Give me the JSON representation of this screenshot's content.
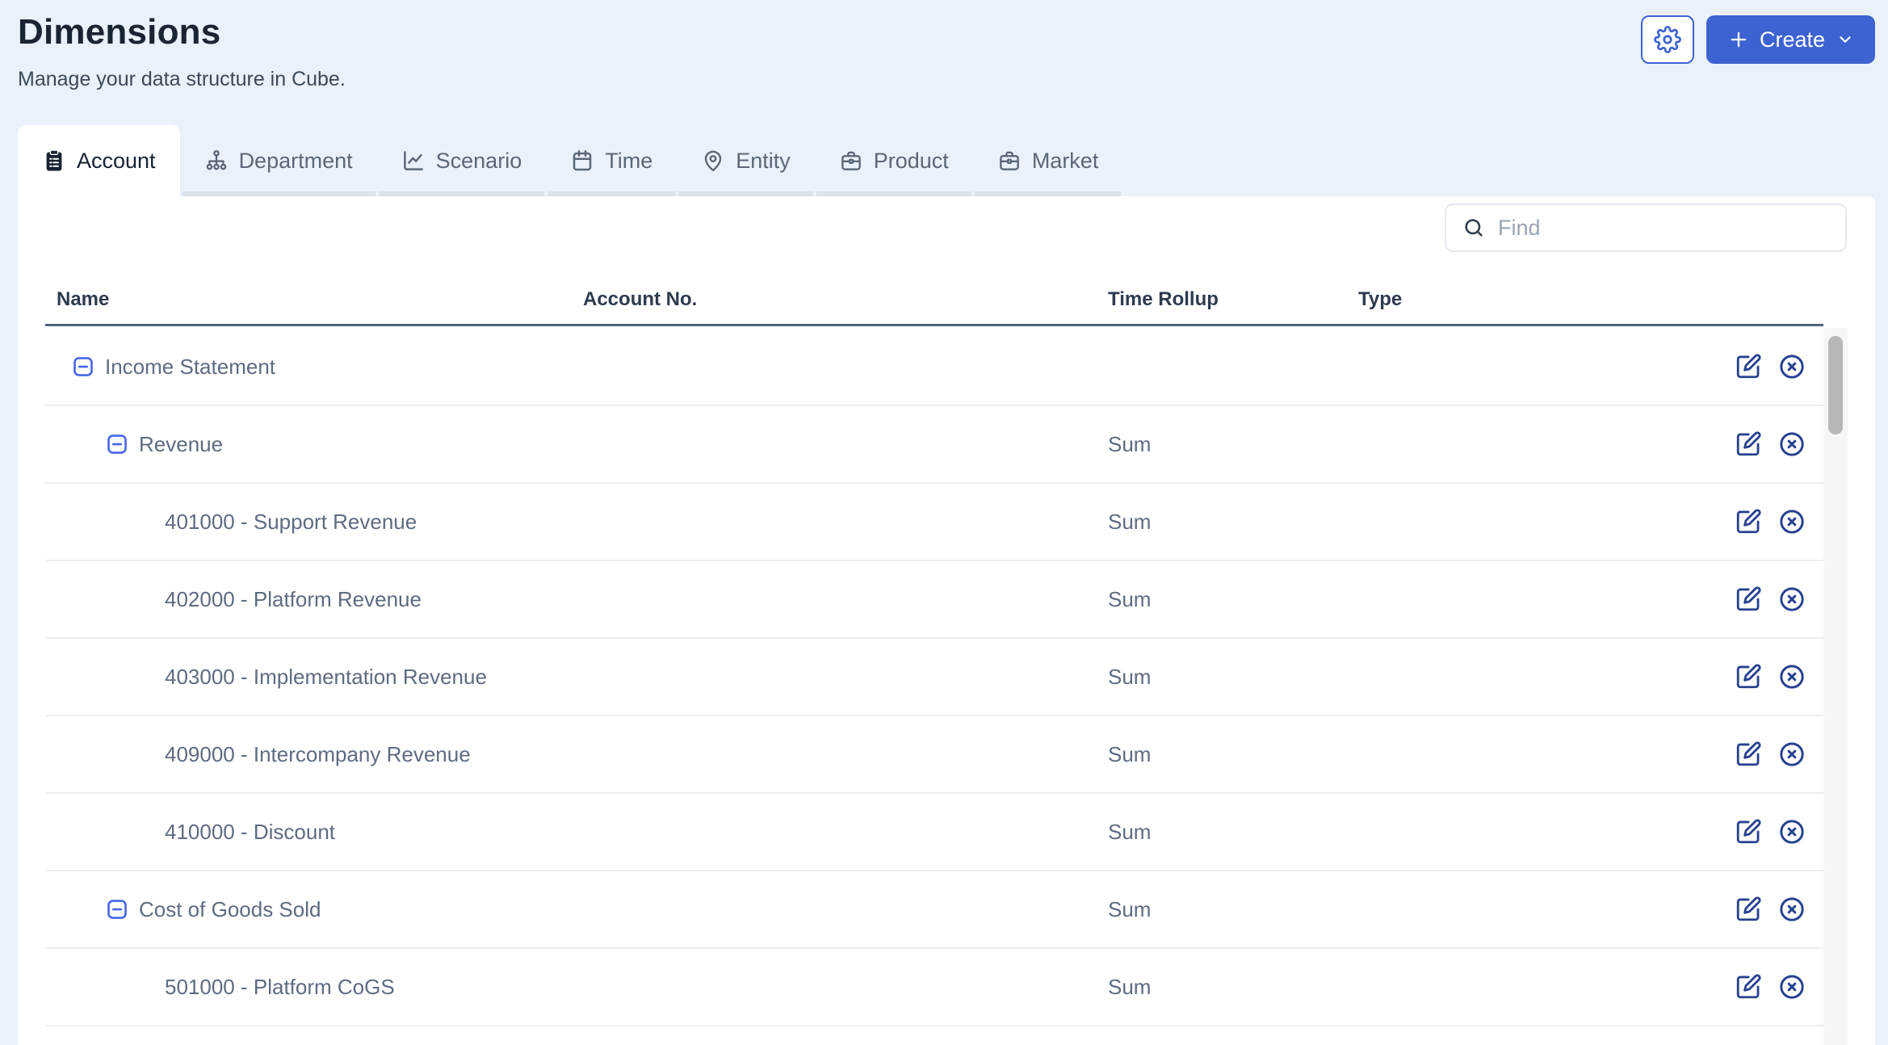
{
  "page": {
    "title": "Dimensions",
    "subtitle": "Manage your data structure in Cube."
  },
  "header_actions": {
    "create_label": "Create"
  },
  "tabs": [
    {
      "label": "Account",
      "icon": "clipboard-icon",
      "active": true
    },
    {
      "label": "Department",
      "icon": "sitemap-icon",
      "active": false
    },
    {
      "label": "Scenario",
      "icon": "chart-line-icon",
      "active": false
    },
    {
      "label": "Time",
      "icon": "calendar-icon",
      "active": false
    },
    {
      "label": "Entity",
      "icon": "map-pin-icon",
      "active": false
    },
    {
      "label": "Product",
      "icon": "briefcase-icon",
      "active": false
    },
    {
      "label": "Market",
      "icon": "briefcase-icon",
      "active": false
    }
  ],
  "search": {
    "placeholder": "Find"
  },
  "table": {
    "columns": [
      "Name",
      "Account No.",
      "Time Rollup",
      "Type"
    ],
    "rows": [
      {
        "name": "Income Statement",
        "level": 0,
        "expandable": true,
        "account_no": "",
        "time_rollup": "",
        "type": ""
      },
      {
        "name": "Revenue",
        "level": 1,
        "expandable": true,
        "account_no": "",
        "time_rollup": "Sum",
        "type": ""
      },
      {
        "name": "401000 - Support Revenue",
        "level": 2,
        "expandable": false,
        "account_no": "",
        "time_rollup": "Sum",
        "type": ""
      },
      {
        "name": "402000 - Platform Revenue",
        "level": 2,
        "expandable": false,
        "account_no": "",
        "time_rollup": "Sum",
        "type": ""
      },
      {
        "name": "403000 - Implementation Revenue",
        "level": 2,
        "expandable": false,
        "account_no": "",
        "time_rollup": "Sum",
        "type": ""
      },
      {
        "name": "409000 - Intercompany Revenue",
        "level": 2,
        "expandable": false,
        "account_no": "",
        "time_rollup": "Sum",
        "type": ""
      },
      {
        "name": "410000 - Discount",
        "level": 2,
        "expandable": false,
        "account_no": "",
        "time_rollup": "Sum",
        "type": ""
      },
      {
        "name": "Cost of Goods Sold",
        "level": 1,
        "expandable": true,
        "account_no": "",
        "time_rollup": "Sum",
        "type": ""
      },
      {
        "name": "501000 - Platform CoGS",
        "level": 2,
        "expandable": false,
        "account_no": "",
        "time_rollup": "Sum",
        "type": ""
      }
    ]
  },
  "colors": {
    "page_background": "#ebf1fa",
    "card_background": "#ffffff",
    "accent_blue": "#3d63d2",
    "collapse_icon_blue": "#4767e6",
    "action_icon_navy": "#27418f",
    "header_border": "#55627b",
    "row_border": "#ededf0",
    "row_text": "#5e6b80",
    "inactive_tab_text": "#5b6778",
    "active_tab_text": "#172233",
    "scroll_thumb": "#b7b7ba"
  }
}
